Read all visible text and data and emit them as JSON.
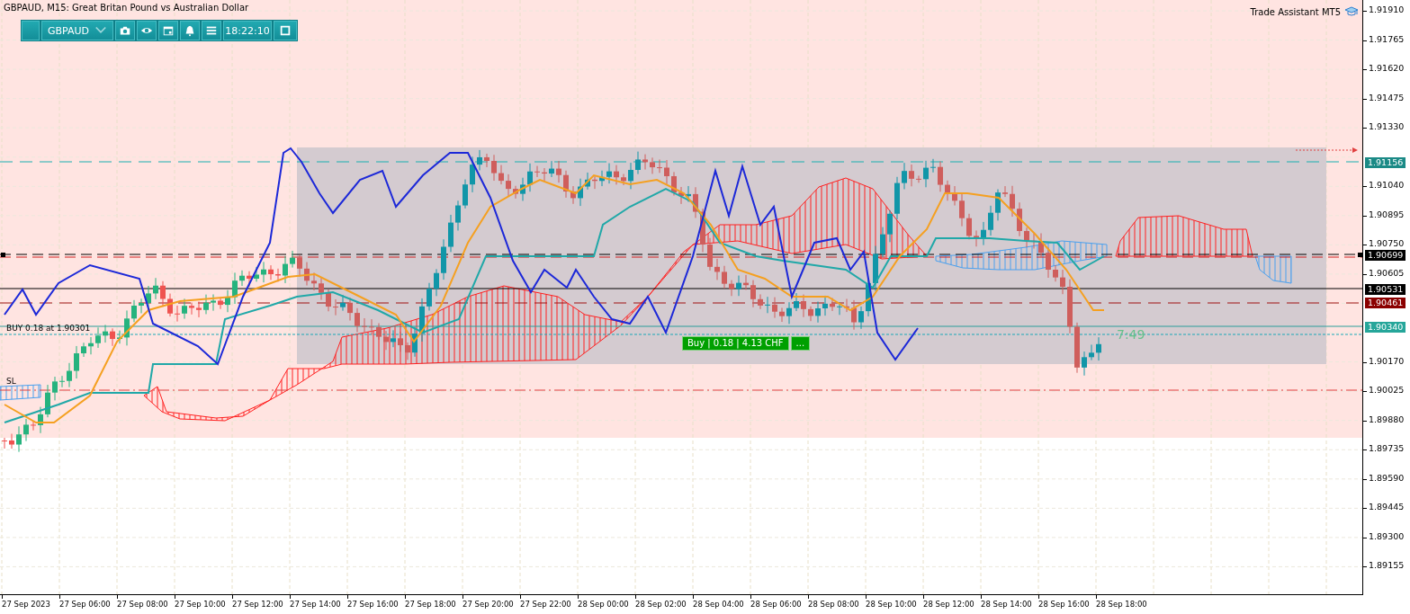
{
  "title": "GBPAUD, M15:  Great Britan Pound vs Australian Dollar",
  "toolbar": {
    "symbol": "GBPAUD",
    "time": "18:22:10"
  },
  "indicator": {
    "name": "Trade Assistant MT5"
  },
  "chart_labels": {
    "position": "BUY 0.18 at 1.90301",
    "stop_loss": "SL",
    "timer": "7:49"
  },
  "trade_button": {
    "label": "Buy | 0.18 | 4.13 CHF",
    "more": "..."
  },
  "price_axis": [
    "1.91910",
    "1.91765",
    "1.91620",
    "1.91475",
    "1.91330",
    "1.91040",
    "1.90895",
    "1.90750",
    "1.90605",
    "1.90170",
    "1.90025",
    "1.89880",
    "1.89735",
    "1.89590",
    "1.89445",
    "1.89300",
    "1.89155"
  ],
  "price_labels": [
    {
      "text": "1.91156",
      "color": "#1b8a86"
    },
    {
      "text": "1.90699",
      "color": "#000000"
    },
    {
      "text": "1.90531",
      "color": "#000000"
    },
    {
      "text": "1.90461",
      "color": "#8b0000"
    },
    {
      "text": "1.90340",
      "color": "#26a69a"
    }
  ],
  "time_axis": [
    "27 Sep 2023",
    "27 Sep 06:00",
    "27 Sep 08:00",
    "27 Sep 10:00",
    "27 Sep 12:00",
    "27 Sep 14:00",
    "27 Sep 16:00",
    "27 Sep 18:00",
    "27 Sep 20:00",
    "27 Sep 22:00",
    "28 Sep 00:00",
    "28 Sep 02:00",
    "28 Sep 04:00",
    "28 Sep 06:00",
    "28 Sep 08:00",
    "28 Sep 10:00",
    "28 Sep 12:00",
    "28 Sep 14:00",
    "28 Sep 16:00",
    "28 Sep 18:00"
  ]
}
